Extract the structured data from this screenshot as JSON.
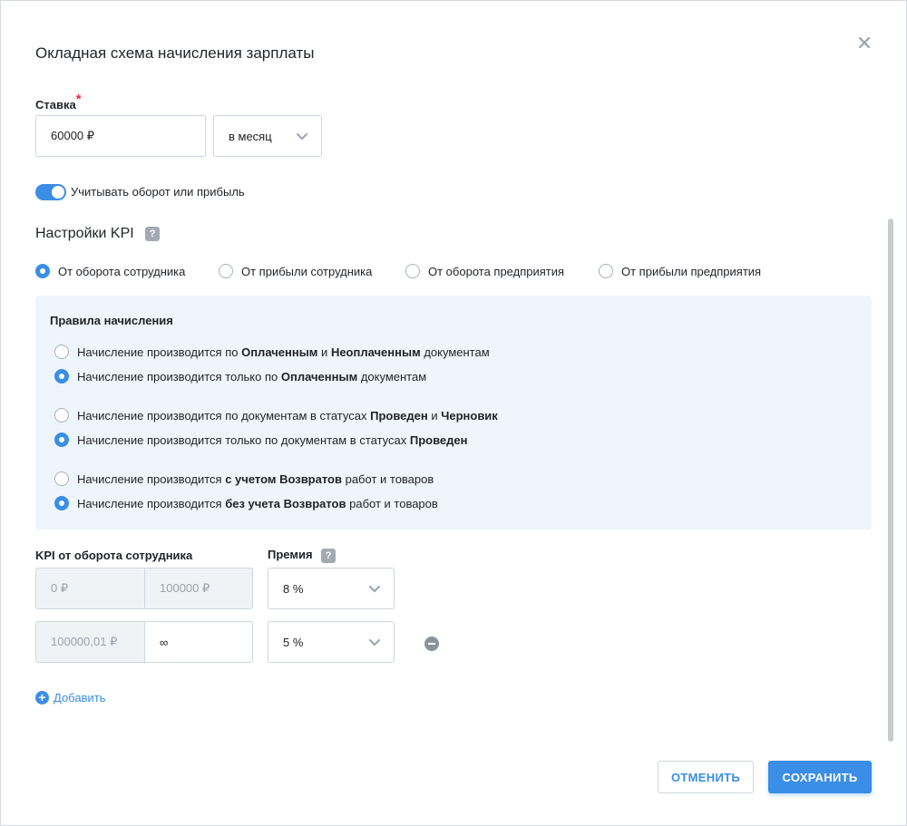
{
  "dialog": {
    "title": "Окладная схема начисления зарплаты",
    "close_icon": "close-icon"
  },
  "rate": {
    "label": "Ставка",
    "required_mark": "*",
    "value": "60000 ₽",
    "period": "в месяц"
  },
  "toggle": {
    "label": "Учитывать оборот или прибыль",
    "on": true
  },
  "kpi": {
    "title": "Настройки KPI",
    "help": "?",
    "options": [
      {
        "label": "От оборота сотрудника",
        "selected": true
      },
      {
        "label": "От прибыли сотрудника",
        "selected": false
      },
      {
        "label": "От оборота предприятия",
        "selected": false
      },
      {
        "label": "От прибыли предприятия",
        "selected": false
      }
    ]
  },
  "rules": {
    "title": "Правила начисления",
    "items": [
      {
        "prefix": "Начисление производится по ",
        "b1": "Оплаченным",
        "mid": " и ",
        "b2": "Неоплаченным",
        "suffix": " документам",
        "selected": false
      },
      {
        "prefix": "Начисление производится только по ",
        "b1": "Оплаченным",
        "mid": "",
        "b2": "",
        "suffix": " документам",
        "selected": true
      },
      {
        "prefix": "Начисление производится по документам в статусах ",
        "b1": "Проведен",
        "mid": " и ",
        "b2": "Черновик",
        "suffix": "",
        "selected": false
      },
      {
        "prefix": "Начисление производится только по документам в статусах ",
        "b1": "Проведен",
        "mid": "",
        "b2": "",
        "suffix": "",
        "selected": true
      },
      {
        "prefix": "Начисление производится ",
        "b1": "с учетом Возвратов",
        "mid": "",
        "b2": "",
        "suffix": " работ и товаров",
        "selected": false
      },
      {
        "prefix": "Начисление производится ",
        "b1": "без учета Возвратов",
        "mid": "",
        "b2": "",
        "suffix": " работ и товаров",
        "selected": true
      }
    ]
  },
  "kpi_table": {
    "label": "KPI от оборота сотрудника",
    "bonus_label": "Премия",
    "bonus_help": "?",
    "rows": [
      {
        "from": "0 ₽",
        "to": "100000 ₽",
        "bonus": "8 %"
      },
      {
        "from": "100000,01 ₽",
        "to": "∞",
        "bonus": "5 %"
      }
    ]
  },
  "add_label": "Добавить",
  "buttons": {
    "cancel": "ОТМЕНИТЬ",
    "save": "СОХРАНИТЬ"
  },
  "colors": {
    "accent": "#3a8ee6",
    "rules_bg": "#eef5fc",
    "required": "#e0323a"
  }
}
